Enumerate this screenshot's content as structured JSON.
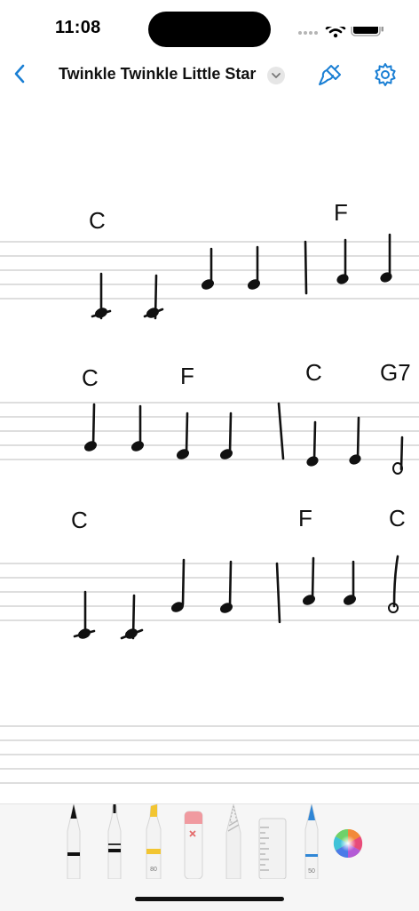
{
  "status": {
    "time": "11:08"
  },
  "nav": {
    "title": "Twinkle Twinkle Little Star"
  },
  "sheet": {
    "system1_chords": [
      "C",
      "F"
    ],
    "system2_chords": [
      "C",
      "F",
      "C",
      "G7"
    ],
    "system3_chords": [
      "C",
      "F",
      "C"
    ]
  },
  "toolbar": {
    "highlighter_width": "80",
    "crayon_width": "50",
    "colors": {
      "pen": "#111111",
      "highlighter": "#f2c531",
      "eraser": "#f09aa0",
      "crayon": "#2f86d6",
      "accent": "#1a7fd4"
    }
  }
}
